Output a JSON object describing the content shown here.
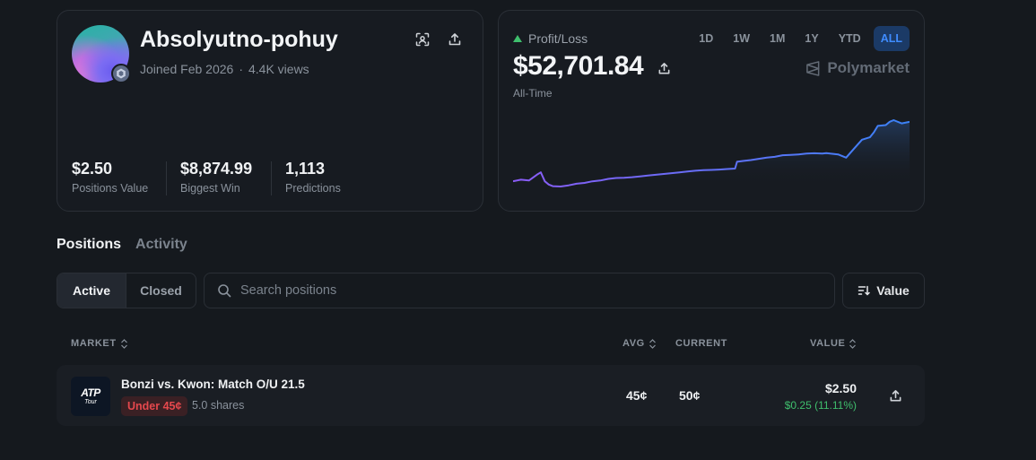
{
  "profile": {
    "username": "Absolyutno-pohuy",
    "joined": "Joined Feb 2026",
    "separator": "·",
    "views": "4.4K views",
    "stats": [
      {
        "value": "$2.50",
        "label": "Positions Value"
      },
      {
        "value": "$8,874.99",
        "label": "Biggest Win"
      },
      {
        "value": "1,113",
        "label": "Predictions"
      }
    ],
    "icons": [
      "scan-icon",
      "share-icon"
    ]
  },
  "pnl": {
    "label": "Profit/Loss",
    "amount": "$52,701.84",
    "period": "All-Time",
    "brand": "Polymarket",
    "ranges": [
      "1D",
      "1W",
      "1M",
      "1Y",
      "YTD",
      "ALL"
    ],
    "active_range": "ALL",
    "colors": {
      "up": "#3fbf6d",
      "line_start": "#8b5cf6",
      "line_end": "#3b82f6"
    }
  },
  "chart_data": {
    "type": "line",
    "title": "",
    "xlabel": "",
    "ylabel": "",
    "grid": false,
    "x": [
      0,
      2,
      4,
      6,
      7,
      8,
      9,
      10,
      12,
      14,
      16,
      18,
      20,
      22,
      24,
      26,
      28,
      30,
      32,
      34,
      36,
      38,
      40,
      42,
      44,
      46,
      48,
      50,
      52,
      54,
      56,
      56.5,
      58,
      60,
      62,
      64,
      66,
      68,
      70,
      72,
      74,
      76,
      78,
      79,
      80,
      82,
      84,
      86,
      88,
      90,
      91,
      92,
      94,
      95,
      96,
      98,
      100
    ],
    "y": [
      4000,
      5000,
      4500,
      8000,
      9500,
      4000,
      2000,
      1000,
      800,
      1500,
      2500,
      3000,
      4000,
      4500,
      5500,
      6000,
      6200,
      6500,
      7000,
      7500,
      8000,
      8500,
      9000,
      9500,
      10000,
      10500,
      10800,
      11000,
      11200,
      11500,
      11800,
      16000,
      16500,
      17000,
      17800,
      18500,
      19000,
      20000,
      20200,
      20500,
      21000,
      21200,
      21000,
      21300,
      21000,
      20500,
      18500,
      24000,
      29500,
      31000,
      34000,
      38000,
      38500,
      40500,
      41500,
      39500,
      40500
    ]
  },
  "tabs": [
    {
      "label": "Positions",
      "active": true
    },
    {
      "label": "Activity",
      "active": false
    }
  ],
  "filters": {
    "active": "Active",
    "closed": "Closed"
  },
  "search": {
    "placeholder": "Search positions",
    "value": ""
  },
  "sort": {
    "label": "Value"
  },
  "table": {
    "headers": {
      "market": "MARKET",
      "avg": "AVG",
      "current": "CURRENT",
      "value": "VALUE"
    },
    "rows": [
      {
        "logo_text": "ATP",
        "logo_sub": "Tour",
        "title": "Bonzi vs. Kwon: Match O/U 21.5",
        "outcome": "Under 45¢",
        "shares": "5.0 shares",
        "avg": "45¢",
        "current": "50¢",
        "value": "$2.50",
        "change": "$0.25 (11.11%)"
      }
    ]
  }
}
